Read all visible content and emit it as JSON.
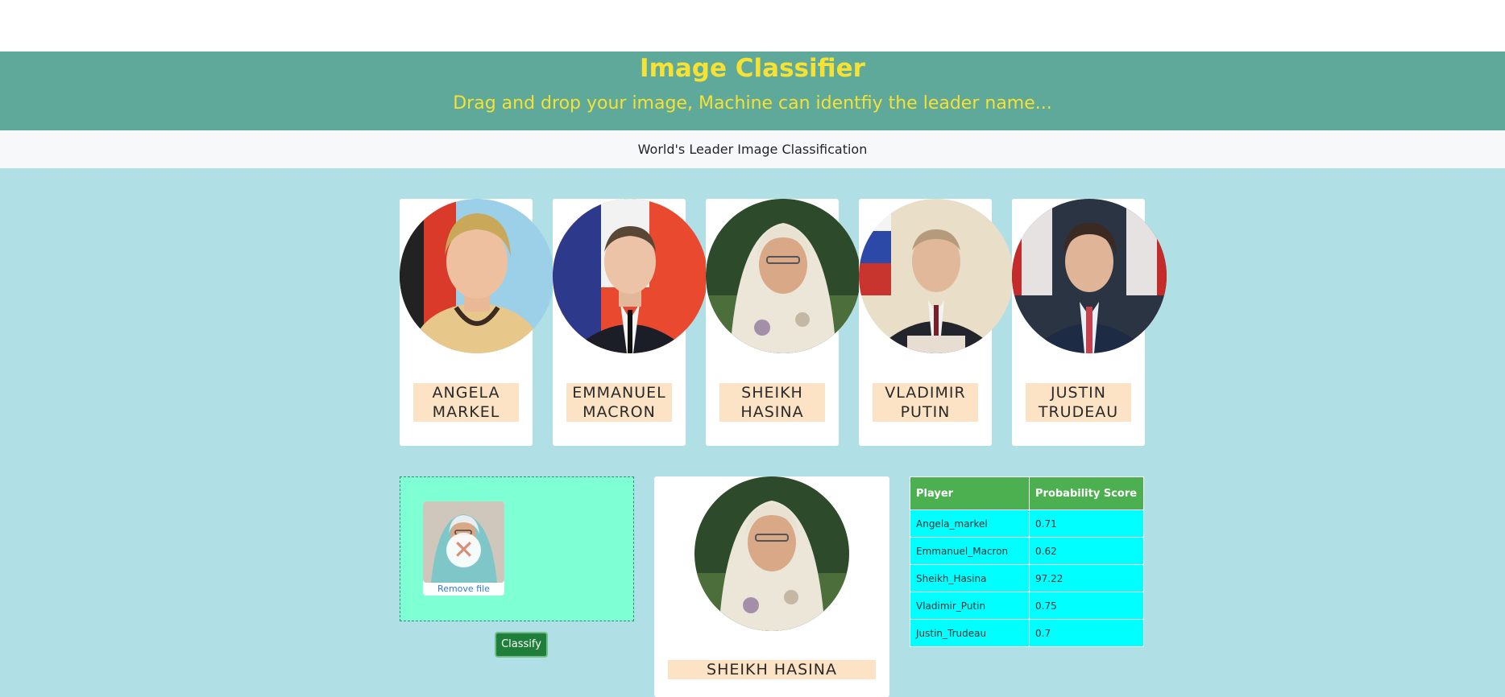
{
  "header": {
    "title": "Image Classifier",
    "subtitle": "Drag and drop your image, Machine can identfiy the leader name..."
  },
  "navbar": {
    "text": "World's Leader Image Classification"
  },
  "leaders": [
    {
      "label": "ANGELA MARKEL"
    },
    {
      "label": "EMMANUEL MACRON"
    },
    {
      "label": "SHEIKH HASINA"
    },
    {
      "label": "VLADIMIR PUTIN"
    },
    {
      "label": "JUSTIN TRUDEAU"
    }
  ],
  "dropzone": {
    "remove_label": "Remove file",
    "remove_icon": "close-icon"
  },
  "classify_button": "Classify",
  "result": {
    "label": "SHEIKH HASINA"
  },
  "score_table": {
    "headers": [
      "Player",
      "Probability Score"
    ],
    "rows": [
      {
        "player": "Angela_markel",
        "score": "0.71"
      },
      {
        "player": "Emmanuel_Macron",
        "score": "0.62"
      },
      {
        "player": "Sheikh_Hasina",
        "score": "97.22"
      },
      {
        "player": "Vladimir_Putin",
        "score": "0.75"
      },
      {
        "player": "Justin_Trudeau",
        "score": "0.7"
      }
    ]
  },
  "colors": {
    "header_bg": "#5ea99a",
    "title_color": "#f7e133",
    "main_bg": "#b0dfe5",
    "label_bg": "#fde3c5",
    "dropzone_bg": "#7effd4",
    "table_header": "#4caf50",
    "table_cell": "#00ffff",
    "button_bg": "#1f7f3a"
  }
}
